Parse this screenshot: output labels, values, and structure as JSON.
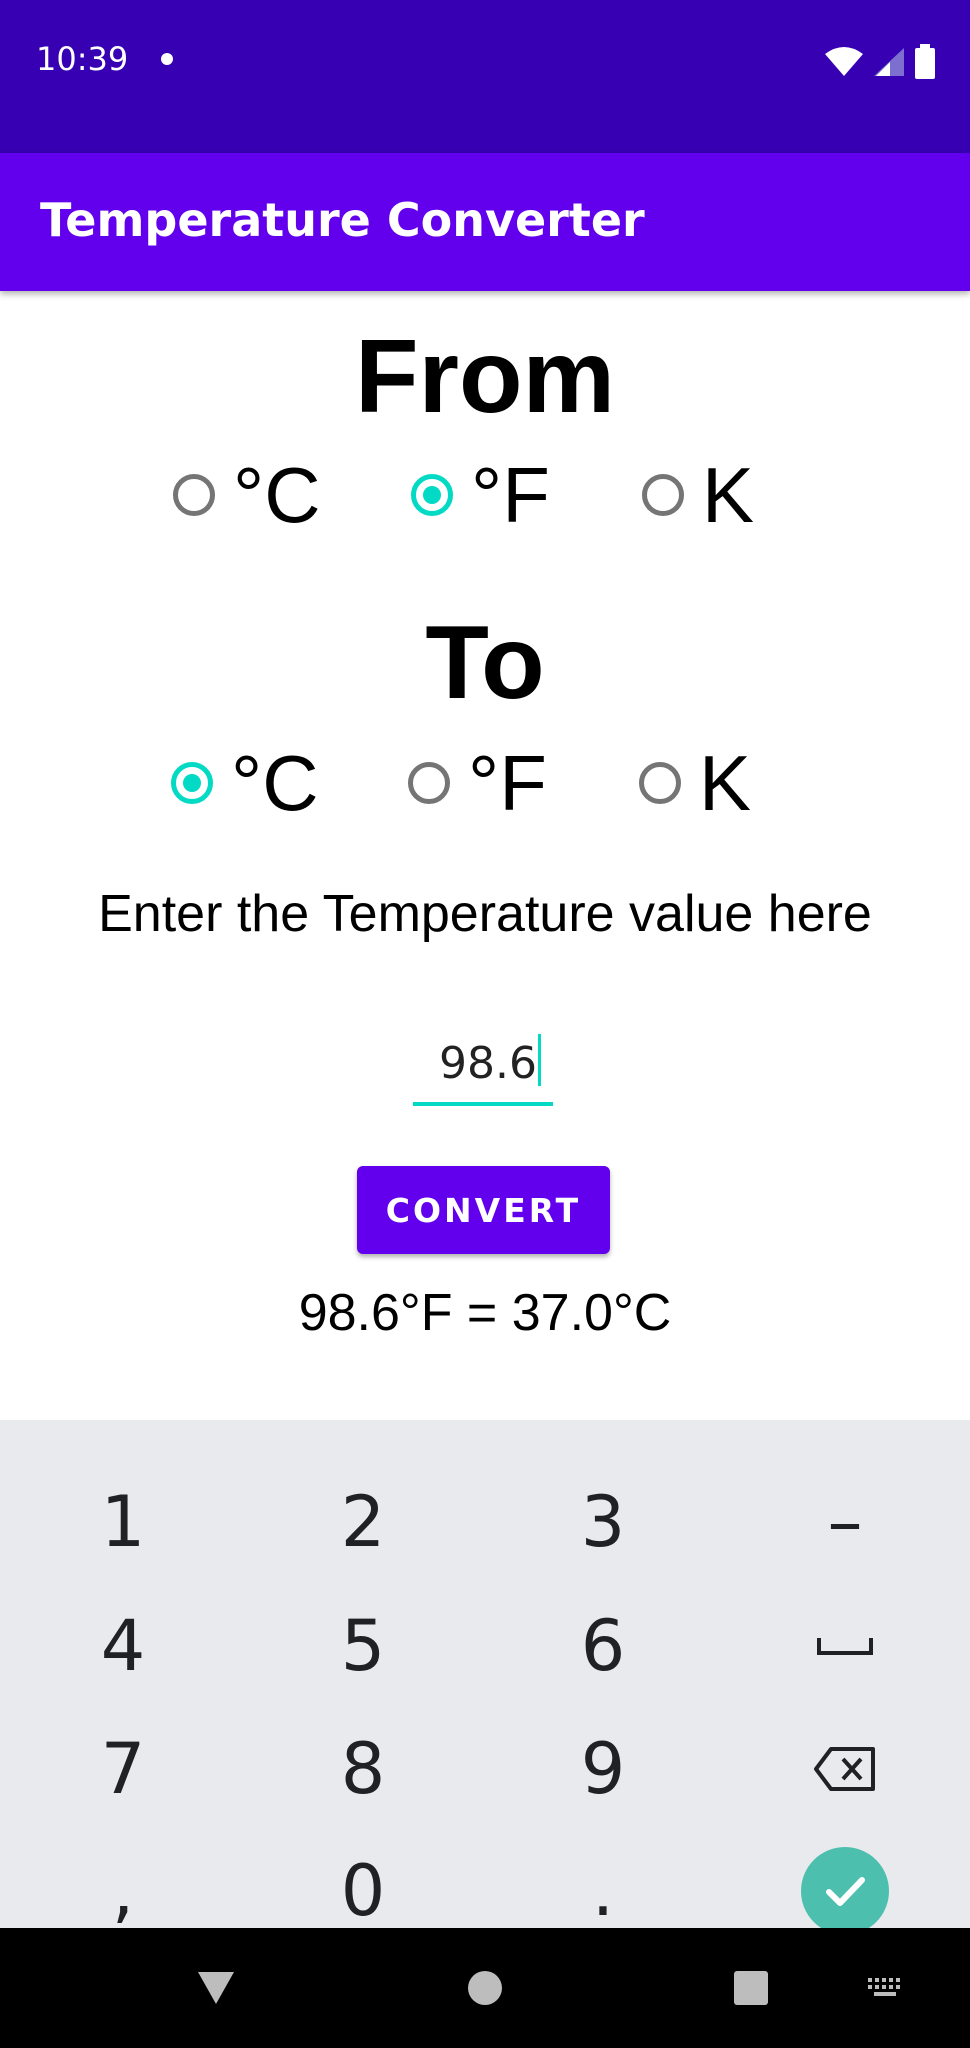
{
  "status_bar": {
    "time": "10:39"
  },
  "app_bar": {
    "title": "Temperature Converter"
  },
  "from": {
    "heading": "From",
    "options": [
      {
        "label": "°C",
        "checked": false
      },
      {
        "label": "°F",
        "checked": true
      },
      {
        "label": "K",
        "checked": false
      }
    ]
  },
  "to": {
    "heading": "To",
    "options": [
      {
        "label": "°C",
        "checked": true
      },
      {
        "label": "°F",
        "checked": false
      },
      {
        "label": "K",
        "checked": false
      }
    ]
  },
  "prompt": "Enter the Temperature value here",
  "input": {
    "value": "98.6"
  },
  "convert_button": {
    "label": "CONVERT"
  },
  "result": "98.6°F = 37.0°C",
  "keyboard": {
    "keys": [
      "1",
      "2",
      "3",
      "–",
      "4",
      "5",
      "6",
      "7",
      "8",
      "9",
      ",",
      "0",
      "."
    ]
  },
  "colors": {
    "primary": "#6200ee",
    "primary_dark": "#3700b3",
    "accent": "#03dac5"
  }
}
